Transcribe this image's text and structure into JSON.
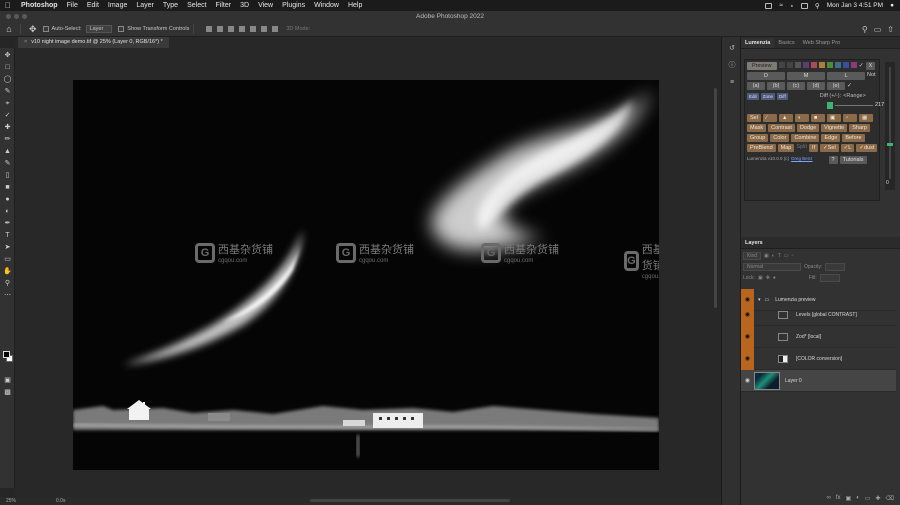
{
  "menubar": {
    "app": "Photoshop",
    "items": [
      "File",
      "Edit",
      "Image",
      "Layer",
      "Type",
      "Select",
      "Filter",
      "3D",
      "View",
      "Plugins",
      "Window",
      "Help"
    ],
    "clock": "Mon Jan 3  4:51 PM"
  },
  "window": {
    "title": "Adobe Photoshop 2022"
  },
  "options": {
    "auto_select_label": "Auto-Select:",
    "auto_select_value": "Layer",
    "transform_label": "Show Transform Controls",
    "mode_3d": "3D Mode:"
  },
  "document": {
    "tab_title": "v10 night image demo.tif @ 25% (Layer 0, RGB/16*) *"
  },
  "watermark": {
    "text_cn": "西基杂货铺",
    "url": "cgqou.com",
    "logo_letter": "G"
  },
  "status": {
    "zoom": "25%",
    "doc": "0.0s"
  },
  "panel": {
    "tabs": [
      "Lumenzia",
      "Basics",
      "Web Sharp Pro"
    ],
    "lumenzia": {
      "preview": "Preview",
      "zone_labels": [
        "D",
        "M",
        "L"
      ],
      "not_label": "Not",
      "zone_buttons": [
        "(a)",
        "(b)",
        "(c)",
        "(d)",
        "(e)"
      ],
      "mode_buttons": [
        "Edit",
        "Zone",
        "Diff"
      ],
      "diff_label": "Diff (+/-):",
      "range_label": "<Range>",
      "value": "217",
      "row1": [
        "Sel",
        "",
        "",
        "",
        "",
        "",
        "",
        ""
      ],
      "row2": [
        "Mask",
        "Contrast",
        "Dodge",
        "Vignette",
        "Sharp"
      ],
      "row3": [
        "Group",
        "Color",
        "Combine",
        "Edge",
        "Before"
      ],
      "row4": [
        "PreBlend",
        "Map",
        "Split",
        "If",
        "✓Sel",
        "✓L",
        "✓dust"
      ],
      "version_text": "Lumenzia v10.0.0 (c)",
      "version_link": "Greg Benz",
      "help": "?",
      "tutorials": "Tutorials",
      "meter_value": "0",
      "meter_level": 0.68
    },
    "layers": {
      "title": "Layers",
      "kind": "Kind",
      "blend_mode": "Normal",
      "opacity_label": "Opacity:",
      "fill_label": "Fill:",
      "lock_label": "Lock:",
      "rows": [
        {
          "name": "Lumenzia preview"
        },
        {
          "name": "Levels [global CONTRAST]"
        },
        {
          "name": "Zod* [local]"
        },
        {
          "name": "[COLOR conversion]"
        },
        {
          "name": "Layer 0"
        }
      ]
    }
  },
  "colors": {
    "menubar_bg": "#1b1b1b",
    "panel_bg": "#323232",
    "accent_orange": "#b8661f",
    "lumenzia_button": "#8a6a48",
    "photo_bg": "#050505"
  }
}
